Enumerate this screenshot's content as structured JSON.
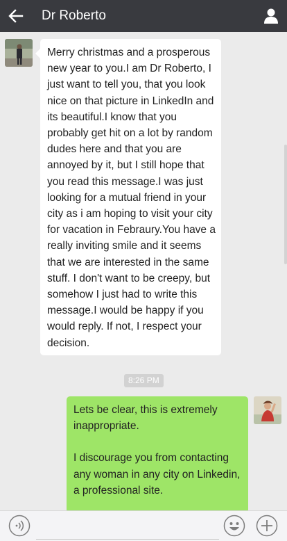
{
  "header": {
    "title": "Dr  Roberto",
    "back_icon": "arrow-left-icon",
    "profile_icon": "person-icon"
  },
  "messages": [
    {
      "direction": "incoming",
      "avatar": "avatar-dr-roberto",
      "text": "Merry christmas and a prosperous new year to you.I am Dr Roberto, I just want to tell you, that you look nice on that picture in LinkedIn and its beautiful.I know that you probably get hit on a lot by random dudes here and that you are annoyed by it, but I still hope that you read this message.I was just looking for a mutual friend in your city as i am hoping to visit your city for vacation in Febraury.You have a really inviting smile and it seems that we are interested in the same stuff. I don't want to be creepy, but somehow I just had to write this message.I would be happy if you would reply. If not, I respect your decision."
    },
    {
      "direction": "outgoing",
      "avatar": "avatar-me",
      "paragraphs": [
        "Lets be clear, this is extremely inappropriate.",
        "I discourage you from contacting any woman in any city on Linkedin, a professional site."
      ]
    }
  ],
  "timestamp": "8:26 PM",
  "input_bar": {
    "placeholder": "",
    "voice_icon": "voice-icon",
    "emoji_icon": "emoji-icon",
    "plus_icon": "plus-icon"
  },
  "colors": {
    "header_bg": "#393a3f",
    "chat_bg": "#ebebeb",
    "outgoing_bubble": "#9ee567",
    "incoming_bubble": "#ffffff"
  }
}
